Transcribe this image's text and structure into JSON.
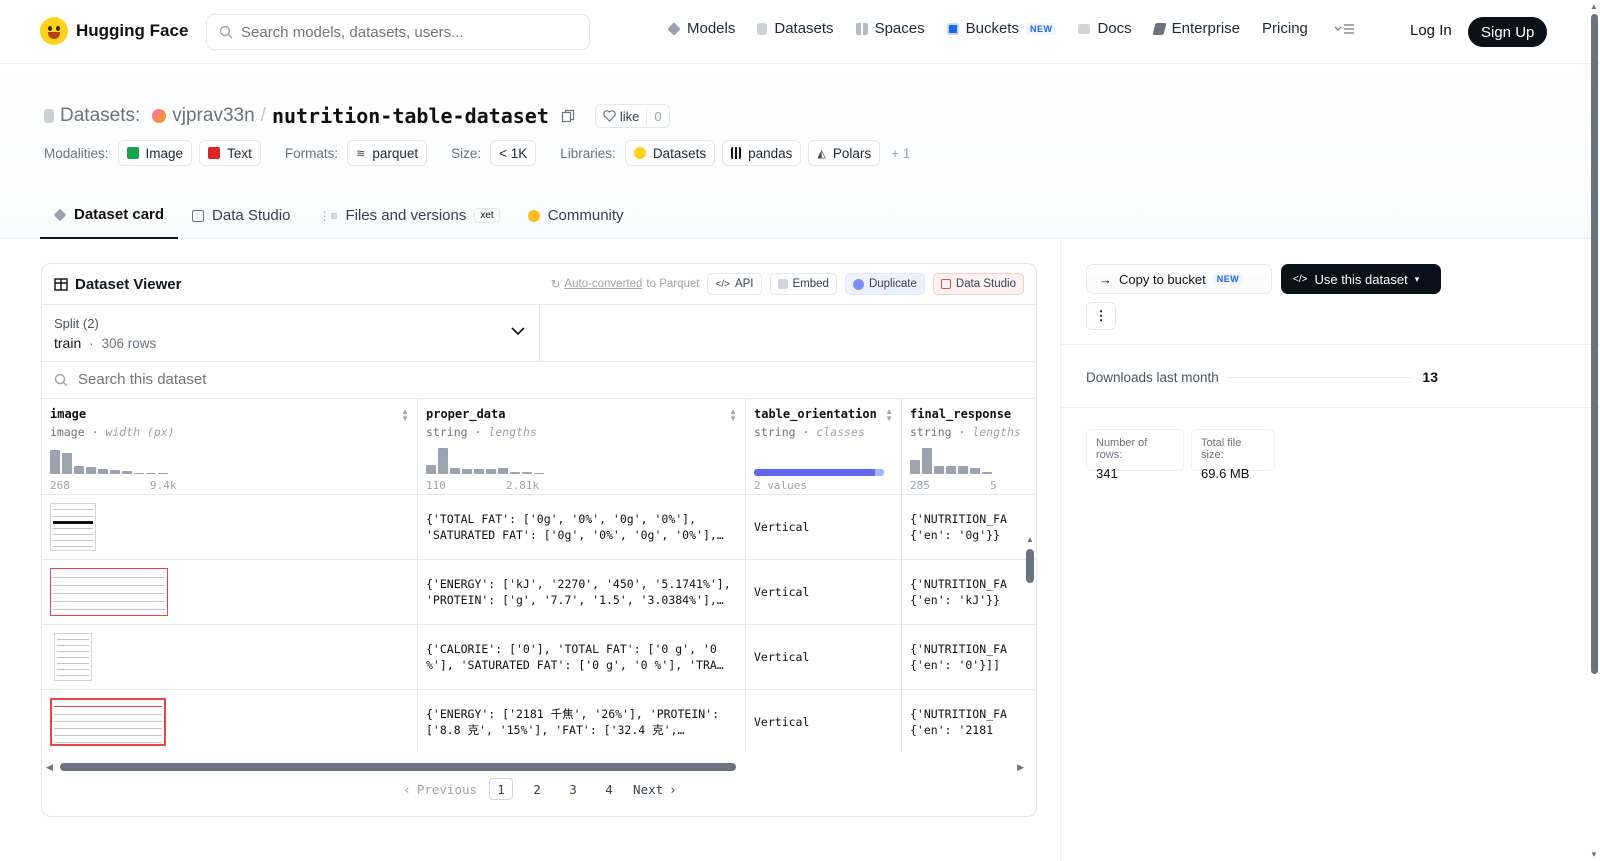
{
  "header": {
    "brand": "Hugging Face",
    "search_placeholder": "Search models, datasets, users...",
    "nav": [
      {
        "label": "Models",
        "icon": "cube-icon",
        "color": "#6b7280"
      },
      {
        "label": "Datasets",
        "icon": "database-icon",
        "color": "#9ca3af"
      },
      {
        "label": "Spaces",
        "icon": "grid-icon",
        "color": "#9ca3af"
      },
      {
        "label": "Buckets",
        "icon": "bucket-icon",
        "color": "#2563eb",
        "badge": "NEW"
      },
      {
        "label": "Docs",
        "icon": "book-icon",
        "color": "#9ca3af"
      },
      {
        "label": "Enterprise",
        "icon": "enterprise-icon",
        "color": "#6b7280"
      },
      {
        "label": "Pricing"
      }
    ],
    "login": "Log In",
    "signup": "Sign Up"
  },
  "repo": {
    "kind": "Datasets:",
    "owner": "vjprav33n",
    "separator": "/",
    "name": "nutrition-table-dataset",
    "like_label": "like",
    "like_count": "0"
  },
  "tags": {
    "modalities_label": "Modalities:",
    "modalities": [
      "Image",
      "Text"
    ],
    "formats_label": "Formats:",
    "format": "parquet",
    "size_label": "Size:",
    "size": "< 1K",
    "libraries_label": "Libraries:",
    "libraries": [
      "Datasets",
      "pandas",
      "Polars"
    ],
    "more": "+ 1"
  },
  "tabs": [
    {
      "label": "Dataset card",
      "active": true
    },
    {
      "label": "Data Studio"
    },
    {
      "label": "Files and versions",
      "badge": "xet"
    },
    {
      "label": "Community"
    }
  ],
  "viewer": {
    "title": "Dataset Viewer",
    "auto_link": "Auto-converted",
    "auto_suffix": "to Parquet",
    "api": "API",
    "embed": "Embed",
    "duplicate": "Duplicate",
    "data_studio": "Data Studio",
    "split_label": "Split (2)",
    "split_value": "train",
    "split_dot": "·",
    "split_rows": "306 rows",
    "search_placeholder": "Search this dataset",
    "columns": [
      {
        "name": "image",
        "type": "image",
        "stat": "width (px)",
        "hist": [
          0.9,
          0.78,
          0.3,
          0.25,
          0.18,
          0.14,
          0.12,
          0.05,
          0.03,
          0.05
        ],
        "min": "268",
        "max": "9.4k"
      },
      {
        "name": "proper_data",
        "type": "string",
        "stat": "lengths",
        "hist": [
          0.35,
          0.95,
          0.22,
          0.2,
          0.2,
          0.2,
          0.22,
          0.08,
          0.06,
          0.04
        ],
        "min": "110",
        "max": "2.81k"
      },
      {
        "name": "table_orientation",
        "type": "string",
        "stat": "classes",
        "classes": [
          0.93,
          0.07
        ],
        "summary": "2 values"
      },
      {
        "name": "final_response",
        "type": "string",
        "stat": "lengths",
        "hist": [
          0.5,
          0.95,
          0.28,
          0.28,
          0.3,
          0.22,
          0.06
        ],
        "min": "285",
        "max": "5"
      }
    ],
    "rows": [
      {
        "proper_data": "{'TOTAL FAT': ['0g', '0%', '0g', '0%'],\n'SATURATED FAT': ['0g', '0%', '0g', '0%'],…",
        "orientation": "Vertical",
        "final": "{'NUTRITION_FA\n{'en': '0g'}}"
      },
      {
        "proper_data": "{'ENERGY': ['kJ', '2270', '450', '5.1741%'],\n'PROTEIN': ['g', '7.7', '1.5', '3.0384%'],…",
        "orientation": "Vertical",
        "final": "{'NUTRITION_FA\n{'en': 'kJ'}}"
      },
      {
        "proper_data": "{'CALORIE': ['0'], 'TOTAL FAT': ['0 g', '0\n%'], 'SATURATED FAT': ['0 g', '0 %'], 'TRA…",
        "orientation": "Vertical",
        "final": "{'NUTRITION_FA\n{'en': '0'}]]"
      },
      {
        "proper_data": "{'ENERGY': ['2181 千焦', '26%'], 'PROTEIN':\n['8.8 克', '15%'], 'FAT': ['32.4 克',…",
        "orientation": "Vertical",
        "final": "{'NUTRITION_FA\n{'en': '2181 "
      }
    ],
    "pager": {
      "prev": "Previous",
      "pages": [
        "1",
        "2",
        "3",
        "4"
      ],
      "current": "1",
      "next": "Next"
    }
  },
  "sidebar": {
    "copy_label": "Copy to bucket",
    "copy_badge": "NEW",
    "use_label": "Use this dataset",
    "downloads_label": "Downloads last month",
    "downloads": "13",
    "rows_label": "Number of rows:",
    "rows_value": "341",
    "size_label": "Total file size:",
    "size_value": "69.6 MB"
  }
}
